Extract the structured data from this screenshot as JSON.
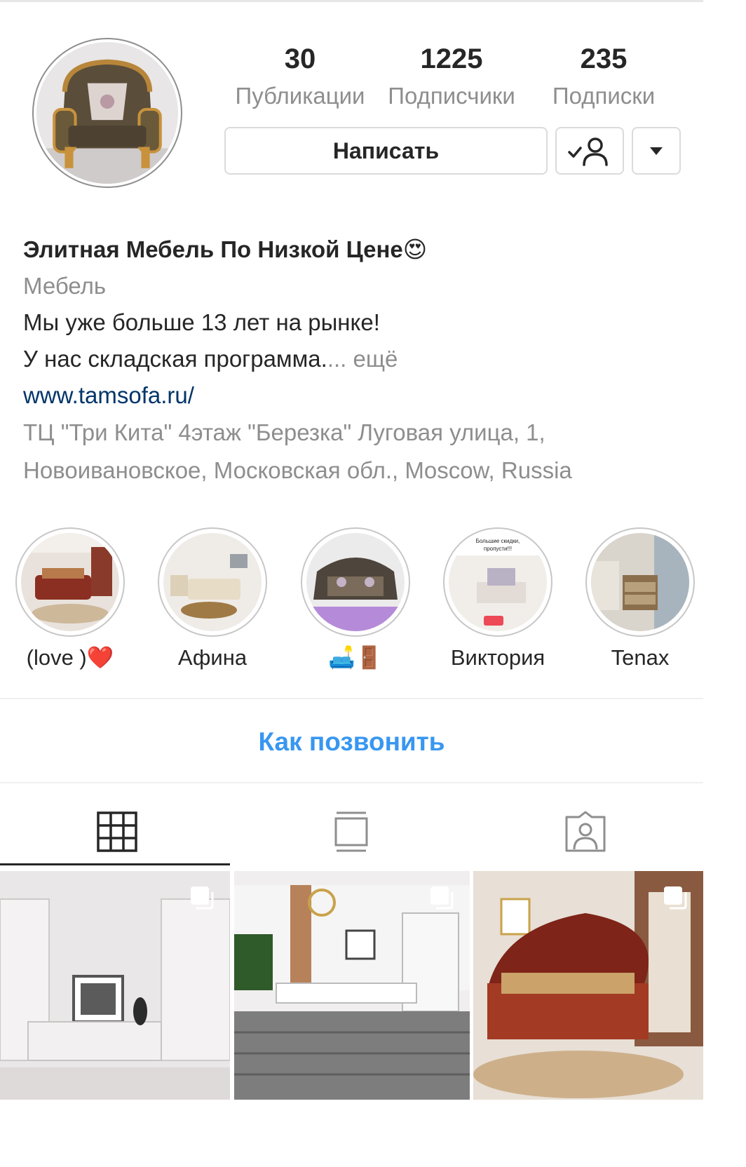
{
  "stats": {
    "posts": {
      "count": "30",
      "label": "Публикации"
    },
    "followers": {
      "count": "1225",
      "label": "Подписчики"
    },
    "following": {
      "count": "235",
      "label": "Подписки"
    }
  },
  "actions": {
    "message_label": "Написать",
    "follow_icon": "following-check-person-icon",
    "more_icon": "caret-down-icon"
  },
  "bio": {
    "name": "Элитная Мебель По Низкой Цене😍",
    "category": "Мебель",
    "line1": "Мы уже больше 13 лет на рынке!",
    "line2": "У нас складская программа.",
    "more": "... ещё",
    "website": "www.tamsofa.ru/",
    "address_line1": "ТЦ \"Три Кита\" 4этаж \"Березка\" Луговая улица, 1,",
    "address_line2": "Новоивановское, Московская обл., Moscow, Russia"
  },
  "highlights": [
    {
      "label": "(love )❤️"
    },
    {
      "label": "Афина"
    },
    {
      "label": "🛋️🚪"
    },
    {
      "label": "Виктория"
    },
    {
      "label": "Tenax"
    }
  ],
  "contact_label": "Как позвонить",
  "tabs": [
    {
      "icon": "grid-icon"
    },
    {
      "icon": "igtv-feed-icon"
    },
    {
      "icon": "tagged-person-icon"
    }
  ],
  "colors": {
    "link": "#003569",
    "accent": "#3897f0",
    "muted": "#8e8e8e",
    "text": "#262626"
  }
}
